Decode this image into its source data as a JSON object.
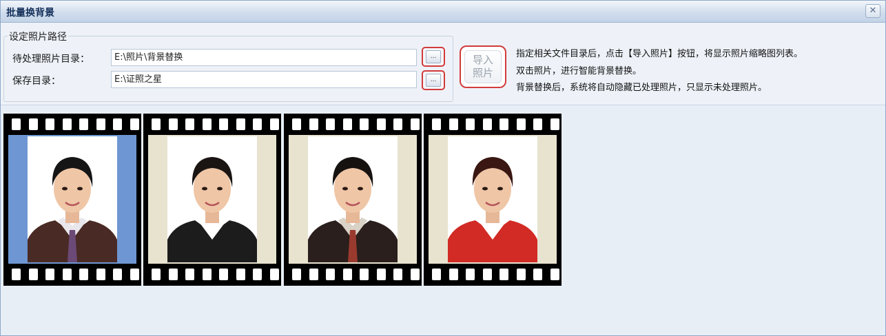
{
  "window": {
    "title": "批量换背景",
    "close_symbol": "✕"
  },
  "settings": {
    "group_title": "设定照片路径",
    "source_label": "待处理照片目录：",
    "source_value": "E:\\照片\\背景替换",
    "save_label": "保存目录：",
    "save_value": "E:\\证照之星",
    "browse_label": "..."
  },
  "import_button": {
    "line1": "导入",
    "line2": "照片"
  },
  "help_lines": [
    "指定相关文件目录后，点击【导入照片】按钮，将显示照片缩略图列表。",
    "双击照片，进行智能背景替换。",
    "背景替换后，系统将自动隐藏已处理照片，只显示未处理照片。"
  ],
  "photos": [
    {
      "name": "photo-1",
      "background": "blue",
      "jacket": "#4a2a24",
      "shirt": "#e9e6ec",
      "tie": "#6b4a77",
      "hair": "#151515"
    },
    {
      "name": "photo-2",
      "background": "cream",
      "jacket": "#1c1c1c",
      "shirt": "#ffffff",
      "tie": "",
      "hair": "#1a1512"
    },
    {
      "name": "photo-3",
      "background": "cream",
      "jacket": "#2a1f1c",
      "shirt": "#d9d2c6",
      "tie": "#9a3a2e",
      "hair": "#161210"
    },
    {
      "name": "photo-4",
      "background": "cream",
      "jacket": "#d22a24",
      "shirt": "#ffffff",
      "tie": "",
      "hair": "#3a1712"
    }
  ],
  "colors": {
    "accent_red": "#d23a3a",
    "title_text": "#15305a",
    "window_bg": "#e8eef6"
  }
}
